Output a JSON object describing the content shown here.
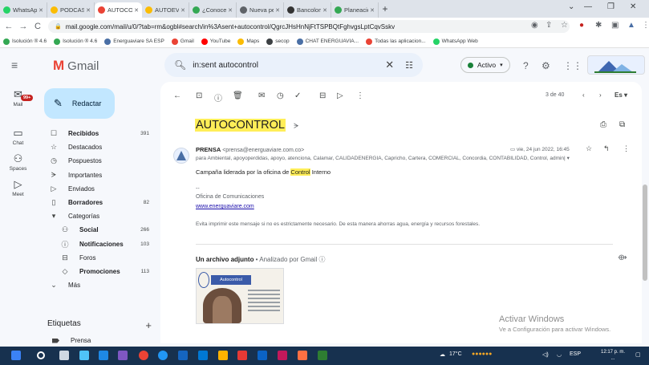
{
  "browser": {
    "tabs": [
      {
        "label": "WhatsApp",
        "color": "#25d366"
      },
      {
        "label": "PODCAST - I",
        "color": "#fbbc04"
      },
      {
        "label": "AUTOCONTR",
        "color": "#ea4335",
        "active": true
      },
      {
        "label": "AUTOEVALU",
        "color": "#fbbc04"
      },
      {
        "label": "¿Conoce ust",
        "color": "#34a853"
      },
      {
        "label": "Nueva pesta",
        "color": "#5f6368"
      },
      {
        "label": "Bancolombi",
        "color": "#333333"
      },
      {
        "label": "Planeación |",
        "color": "#34a853"
      }
    ],
    "url": "mail.google.com/mail/u/0/?tab=rm&ogbl#search/in%3Asent+autocontrol/QgrcJHsHnNjFtTSPBQtFghvgsLptCqvSskv",
    "bookmarks": [
      {
        "label": "Isolución ® 4.6",
        "color": "#34a853"
      },
      {
        "label": "Isolución ® 4.6",
        "color": "#34a853"
      },
      {
        "label": "Energuaviare SA ESP",
        "color": "#4a6fa5"
      },
      {
        "label": "Gmail",
        "color": "#ea4335"
      },
      {
        "label": "YouTube",
        "color": "#ff0000"
      },
      {
        "label": "Maps",
        "color": "#fbbc04"
      },
      {
        "label": "secop",
        "color": "#3c4043"
      },
      {
        "label": "CHAT ENERGUAVIA...",
        "color": "#4a6fa5"
      },
      {
        "label": "Todas las aplicacion...",
        "color": "#ea4335"
      },
      {
        "label": "WhatsApp Web",
        "color": "#25d366"
      }
    ]
  },
  "gmail": {
    "brand": "Gmail",
    "search_value": "in:sent autocontrol",
    "status": "Activo",
    "rail": [
      {
        "label": "Mail",
        "badge": "99+"
      },
      {
        "label": "Chat"
      },
      {
        "label": "Spaces"
      },
      {
        "label": "Meet"
      }
    ],
    "compose": "Redactar",
    "nav": [
      {
        "label": "Recibidos",
        "count": "391",
        "bold": true
      },
      {
        "label": "Destacados",
        "count": ""
      },
      {
        "label": "Pospuestos",
        "count": ""
      },
      {
        "label": "Importantes",
        "count": ""
      },
      {
        "label": "Enviados",
        "count": ""
      },
      {
        "label": "Borradores",
        "count": "82",
        "bold": true
      },
      {
        "label": "Categorías",
        "count": ""
      },
      {
        "label": "Social",
        "count": "266",
        "bold": true,
        "sub": true
      },
      {
        "label": "Notificaciones",
        "count": "103",
        "bold": true,
        "sub": true
      },
      {
        "label": "Foros",
        "count": "",
        "sub": true
      },
      {
        "label": "Promociones",
        "count": "113",
        "bold": true,
        "sub": true
      },
      {
        "label": "Más",
        "count": ""
      }
    ],
    "labels_title": "Etiquetas",
    "labels": [
      "Prensa"
    ]
  },
  "message": {
    "pager": "3 de 40",
    "lang": "Es",
    "subject": "AUTOCONTROL",
    "sender_name": "PRENSA",
    "sender_email": "<prensa@energuaviare.com.co>",
    "date": "vie, 24 jun 2022, 16:45",
    "recipients": "para Ambiental, apoyoperdidas, apoyo, atenciona, Calamar, CALIDADENERGIA, Capricho, Cartera, COMERCIAL, Concordia, CONTABILIDAD, Control, admin|",
    "body_prefix": "Campaña liderada por la oficina de ",
    "body_highlight": "Control",
    "body_suffix": " Interno",
    "sig_dash": "--",
    "sig_office": "Oficina de Comunicaciones",
    "sig_link": "www.energuaviare.com",
    "sig_note": "Evita imprimir este mensaje si no es estrictamente necesario. De esta manera ahorras agua, energía y recursos forestales.",
    "attachment_head": "Un archivo adjunto",
    "attachment_scan": "Analizado por Gmail",
    "attachment_title": "Autocontrol"
  },
  "watermark": {
    "line1": "Activar Windows",
    "line2": "Ve a Configuración para activar Windows."
  },
  "taskbar": {
    "weather": "17°C",
    "lang": "ESP",
    "time": "12:17 p. m.",
    "date": "..."
  }
}
